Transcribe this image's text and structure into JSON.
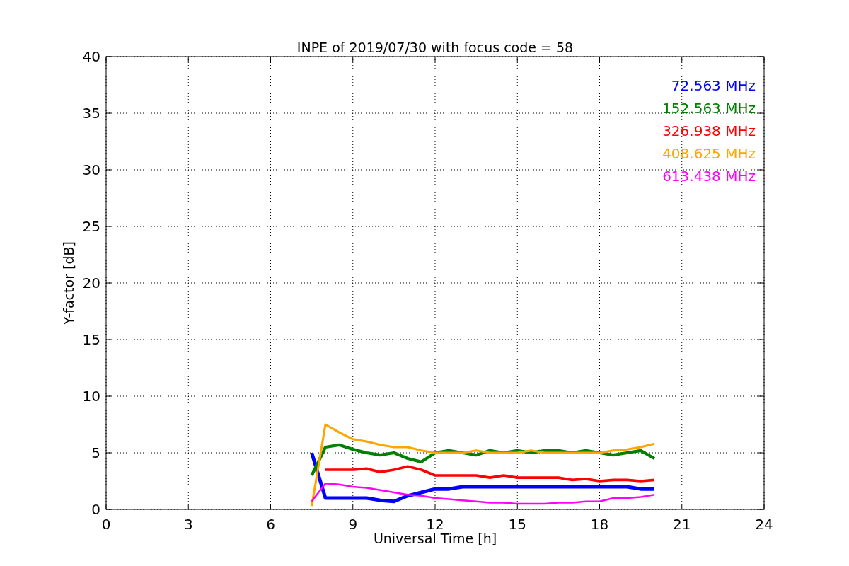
{
  "chart_data": {
    "type": "line",
    "title": "INPE of 2019/07/30 with focus code = 58",
    "xlabel": "Universal Time [h]",
    "ylabel": "Y-factor [dB]",
    "x": [
      7.5,
      8,
      8.5,
      9,
      9.5,
      10,
      10.5,
      11,
      11.5,
      12,
      12.5,
      13,
      13.5,
      14,
      14.5,
      15,
      15.5,
      16,
      16.5,
      17,
      17.5,
      18,
      18.5,
      19,
      19.5,
      20
    ],
    "series": [
      {
        "name": "72.563 MHz",
        "color": "#0000ff",
        "values": [
          5.0,
          1.0,
          1.0,
          1.0,
          1.0,
          0.8,
          0.7,
          1.2,
          1.5,
          1.8,
          1.8,
          2.0,
          2.0,
          2.0,
          2.0,
          2.0,
          2.0,
          2.0,
          2.0,
          2.0,
          2.0,
          2.0,
          2.0,
          2.0,
          1.8,
          1.8
        ]
      },
      {
        "name": "152.563 MHz",
        "color": "#008000",
        "values": [
          3.0,
          5.5,
          5.7,
          5.3,
          5.0,
          4.8,
          5.0,
          4.5,
          4.2,
          5.0,
          5.2,
          5.0,
          4.8,
          5.2,
          5.0,
          5.2,
          5.0,
          5.2,
          5.2,
          5.0,
          5.2,
          5.0,
          4.8,
          5.0,
          5.2,
          4.5
        ]
      },
      {
        "name": "326.938 MHz",
        "color": "#ff0000",
        "values": [
          null,
          3.5,
          3.5,
          3.5,
          3.6,
          3.3,
          3.5,
          3.8,
          3.5,
          3.0,
          3.0,
          3.0,
          3.0,
          2.8,
          3.0,
          2.8,
          2.8,
          2.8,
          2.8,
          2.6,
          2.7,
          2.5,
          2.6,
          2.6,
          2.5,
          2.6
        ]
      },
      {
        "name": "408.625 MHz",
        "color": "#ffa500",
        "values": [
          0.3,
          7.5,
          6.8,
          6.2,
          6.0,
          5.7,
          5.5,
          5.5,
          5.2,
          5.0,
          5.0,
          5.0,
          5.2,
          5.0,
          5.0,
          5.0,
          5.2,
          5.0,
          5.0,
          5.0,
          5.0,
          5.0,
          5.2,
          5.3,
          5.5,
          5.8
        ]
      },
      {
        "name": "613.438 MHz",
        "color": "#ff00ff",
        "values": [
          0.7,
          2.3,
          2.2,
          2.0,
          1.9,
          1.7,
          1.5,
          1.3,
          1.2,
          1.0,
          0.9,
          0.8,
          0.7,
          0.6,
          0.6,
          0.5,
          0.5,
          0.5,
          0.6,
          0.6,
          0.7,
          0.7,
          1.0,
          1.0,
          1.1,
          1.3
        ]
      }
    ],
    "xlim": [
      0,
      24
    ],
    "ylim": [
      0,
      40
    ],
    "xticks": [
      0,
      3,
      6,
      9,
      12,
      15,
      18,
      21,
      24
    ],
    "yticks": [
      0,
      5,
      10,
      15,
      20,
      25,
      30,
      35,
      40
    ],
    "grid": true
  }
}
